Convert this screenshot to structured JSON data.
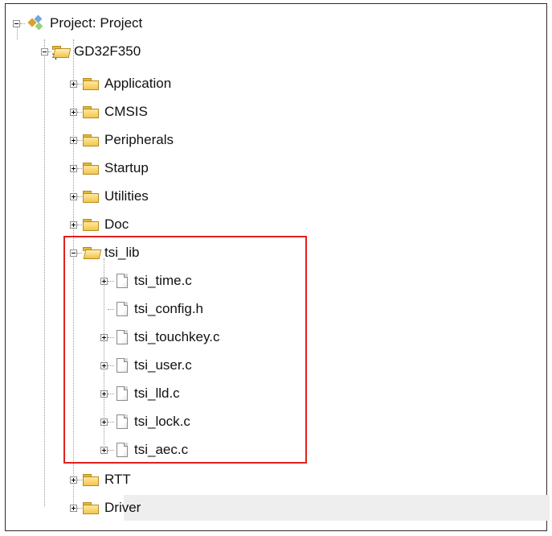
{
  "tree": {
    "project": {
      "label": "Project: Project"
    },
    "target": {
      "label": "GD32F350"
    },
    "groups": [
      {
        "label": "Application"
      },
      {
        "label": "CMSIS"
      },
      {
        "label": "Peripherals"
      },
      {
        "label": "Startup"
      },
      {
        "label": "Utilities"
      },
      {
        "label": "Doc"
      }
    ],
    "tsi_lib": {
      "label": "tsi_lib",
      "files": [
        {
          "label": "tsi_time.c"
        },
        {
          "label": "tsi_config.h"
        },
        {
          "label": "tsi_touchkey.c"
        },
        {
          "label": "tsi_user.c"
        },
        {
          "label": "tsi_lld.c"
        },
        {
          "label": "tsi_lock.c"
        },
        {
          "label": "tsi_aec.c"
        }
      ]
    },
    "tail_groups": [
      {
        "label": "RTT"
      },
      {
        "label": "Driver"
      }
    ]
  },
  "colors": {
    "highlight_box": "#e02020",
    "folder": "#f3c64f",
    "selection": "#eeeeee"
  }
}
